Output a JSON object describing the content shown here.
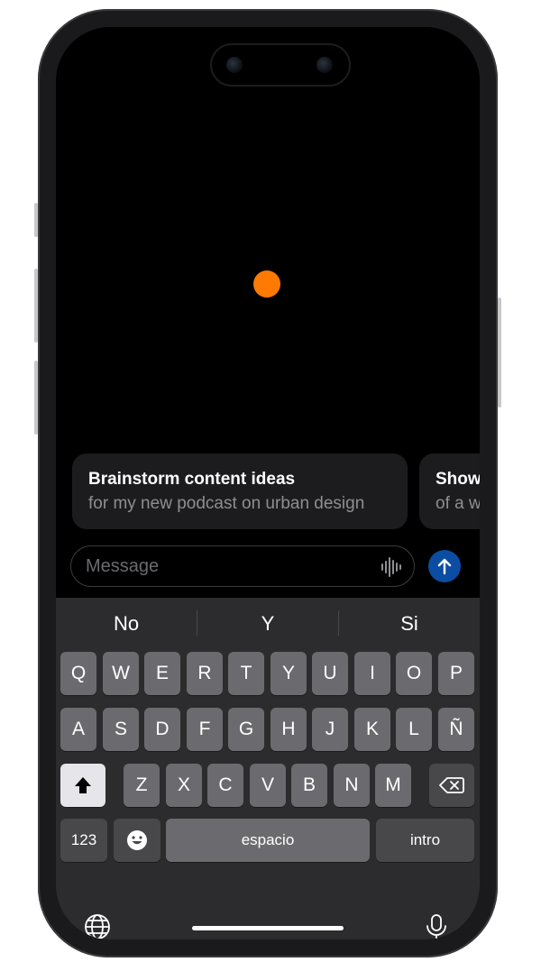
{
  "colors": {
    "accent_dot": "#FF7A00",
    "send_button": "#0B4DA2",
    "keyboard_bg": "#2C2C2E",
    "key_bg": "#6B6B6F"
  },
  "suggestions": [
    {
      "title": "Brainstorm content ideas",
      "subtitle": "for my new podcast on urban design"
    },
    {
      "title": "Show",
      "subtitle": "of a w"
    }
  ],
  "composer": {
    "placeholder": "Message",
    "voice_icon": "waveform-icon",
    "send_icon": "arrow-up-icon"
  },
  "keyboard": {
    "predictions": [
      "No",
      "Y",
      "Si"
    ],
    "row1": [
      "Q",
      "W",
      "E",
      "R",
      "T",
      "Y",
      "U",
      "I",
      "O",
      "P"
    ],
    "row2": [
      "A",
      "S",
      "D",
      "F",
      "G",
      "H",
      "J",
      "K",
      "L",
      "Ñ"
    ],
    "row3": [
      "Z",
      "X",
      "C",
      "V",
      "B",
      "N",
      "M"
    ],
    "numbers_label": "123",
    "space_label": "espacio",
    "return_label": "intro",
    "shift_icon": "shift-icon",
    "delete_icon": "delete-icon",
    "emoji_icon": "emoji-icon",
    "globe_icon": "globe-icon",
    "mic_icon": "microphone-icon"
  }
}
